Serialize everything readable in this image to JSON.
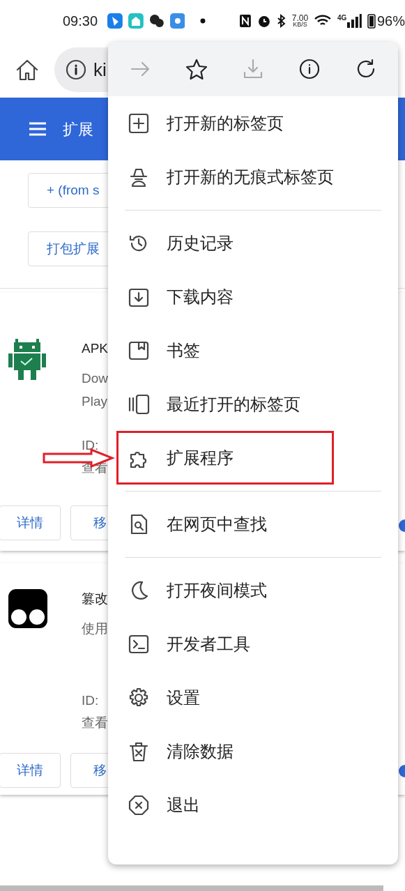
{
  "status_bar": {
    "time": "09:30",
    "apps": [
      {
        "kind": "blue"
      },
      {
        "kind": "home"
      },
      {
        "kind": "chat"
      },
      {
        "kind": "snow"
      }
    ],
    "speed": "7.00",
    "speed_unit": "KB/S",
    "network": "4G",
    "battery": "96%"
  },
  "address_bar": {
    "url": "ki"
  },
  "header": {
    "title": "扩展"
  },
  "actions": [
    "+ (from s",
    "打包扩展"
  ],
  "extensions": [
    {
      "kind": "android",
      "title": "APK",
      "description": [
        "Dow",
        "Play"
      ],
      "id_label": "ID:",
      "view": "查看",
      "buttons": [
        "详情",
        "移"
      ],
      "enabled": true
    },
    {
      "kind": "tampermonkey",
      "title": "篡改",
      "description": [
        "使用"
      ],
      "id_label": "ID:",
      "view": "查看",
      "buttons": [
        "详情",
        "移"
      ],
      "enabled": true
    }
  ],
  "menu": {
    "toolbar": [
      {
        "kind": "forward",
        "disabled": true
      },
      {
        "kind": "star",
        "disabled": false
      },
      {
        "kind": "download",
        "disabled": true
      },
      {
        "kind": "info",
        "disabled": false
      },
      {
        "kind": "reload",
        "disabled": false
      }
    ],
    "items": [
      {
        "kind": "new-tab",
        "label": "打开新的标签页",
        "highlighted": false
      },
      {
        "kind": "incognito",
        "label": "打开新的无痕式标签页",
        "highlighted": false
      },
      {
        "kind": "divider"
      },
      {
        "kind": "history",
        "label": "历史记录",
        "highlighted": false
      },
      {
        "kind": "downloads",
        "label": "下载内容",
        "highlighted": false
      },
      {
        "kind": "bookmarks",
        "label": "书签",
        "highlighted": false
      },
      {
        "kind": "recent-tabs",
        "label": "最近打开的标签页",
        "highlighted": false
      },
      {
        "kind": "extensions",
        "label": "扩展程序",
        "highlighted": true
      },
      {
        "kind": "divider"
      },
      {
        "kind": "find",
        "label": "在网页中查找",
        "highlighted": false
      },
      {
        "kind": "divider"
      },
      {
        "kind": "night",
        "label": "打开夜间模式",
        "highlighted": false
      },
      {
        "kind": "devtools",
        "label": "开发者工具",
        "highlighted": false
      },
      {
        "kind": "settings",
        "label": "设置",
        "highlighted": false
      },
      {
        "kind": "clear",
        "label": "清除数据",
        "highlighted": false
      },
      {
        "kind": "exit",
        "label": "退出",
        "highlighted": false
      }
    ]
  }
}
